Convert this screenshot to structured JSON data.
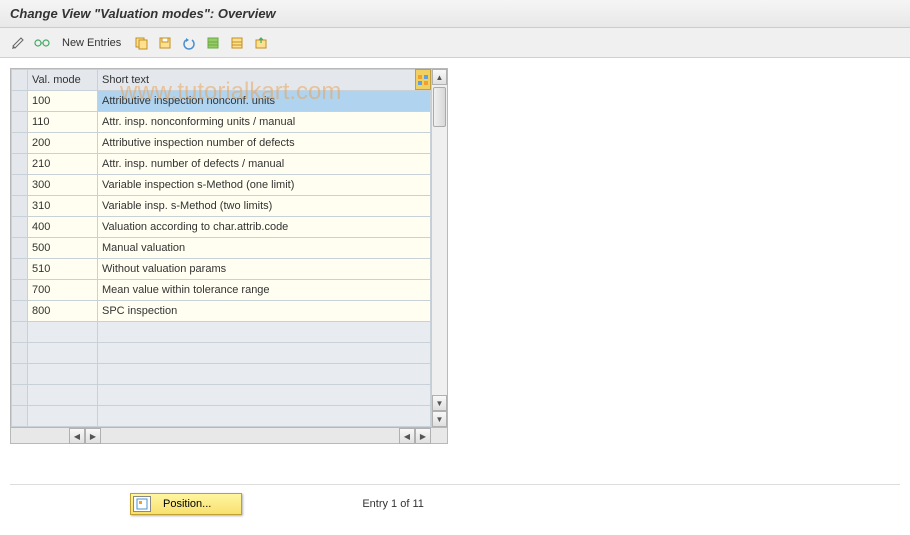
{
  "title": "Change View \"Valuation modes\": Overview",
  "toolbar": {
    "new_entries_label": "New Entries"
  },
  "watermark": "www.tutorialkart.com",
  "columns": {
    "mode": "Val. mode",
    "text": "Short text"
  },
  "rows": [
    {
      "mode": "100",
      "text": "Attributive inspection nonconf. units",
      "selected": true
    },
    {
      "mode": "110",
      "text": "Attr. insp. nonconforming units / manual"
    },
    {
      "mode": "200",
      "text": "Attributive inspection number of defects"
    },
    {
      "mode": "210",
      "text": "Attr. insp. number of defects / manual"
    },
    {
      "mode": "300",
      "text": "Variable inspection s-Method (one limit)"
    },
    {
      "mode": "310",
      "text": "Variable insp. s-Method (two limits)"
    },
    {
      "mode": "400",
      "text": "Valuation according to char.attrib.code"
    },
    {
      "mode": "500",
      "text": "Manual valuation"
    },
    {
      "mode": "510",
      "text": "Without valuation params"
    },
    {
      "mode": "700",
      "text": "Mean value within tolerance range"
    },
    {
      "mode": "800",
      "text": "SPC inspection"
    }
  ],
  "empty_rows": 5,
  "footer": {
    "position_label": "Position...",
    "entry_text": "Entry 1 of 11"
  }
}
